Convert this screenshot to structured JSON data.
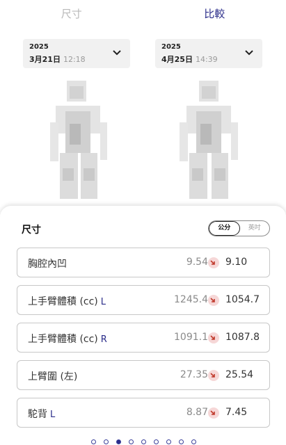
{
  "tabs": [
    {
      "label": "尺寸",
      "active": false
    },
    {
      "label": "比較",
      "active": true
    }
  ],
  "compare": {
    "left": {
      "year": "2025",
      "date": "3月21日",
      "time": "12:18"
    },
    "right": {
      "year": "2025",
      "date": "4月25日",
      "time": "14:39"
    }
  },
  "sheet": {
    "title": "尺寸",
    "units": {
      "cm": "公分",
      "inch": "英吋",
      "selected": "cm"
    },
    "rows": [
      {
        "label": "胸腔內凹",
        "side": "",
        "before": "9.54",
        "after": "9.10",
        "trend": "down"
      },
      {
        "label": "上手臂體積 (cc)",
        "side": "L",
        "before": "1245.4",
        "after": "1054.7",
        "trend": "down"
      },
      {
        "label": "上手臂體積 (cc)",
        "side": "R",
        "before": "1091.1",
        "after": "1087.8",
        "trend": "down"
      },
      {
        "label": "上臂圍 (左)",
        "side": "",
        "before": "27.35",
        "after": "25.54",
        "trend": "down"
      },
      {
        "label": "駝背",
        "side": "L",
        "before": "8.87",
        "after": "7.45",
        "trend": "down"
      }
    ]
  },
  "pager": {
    "count": 9,
    "active_index": 2
  },
  "colors": {
    "accent": "#2b2d8a",
    "trend_down_bg": "#f6d7d7",
    "trend_down_arrow": "#c0392b"
  },
  "icons": {
    "chevron": "chevron-down-icon",
    "trend": "trend-down-arrow-icon"
  }
}
